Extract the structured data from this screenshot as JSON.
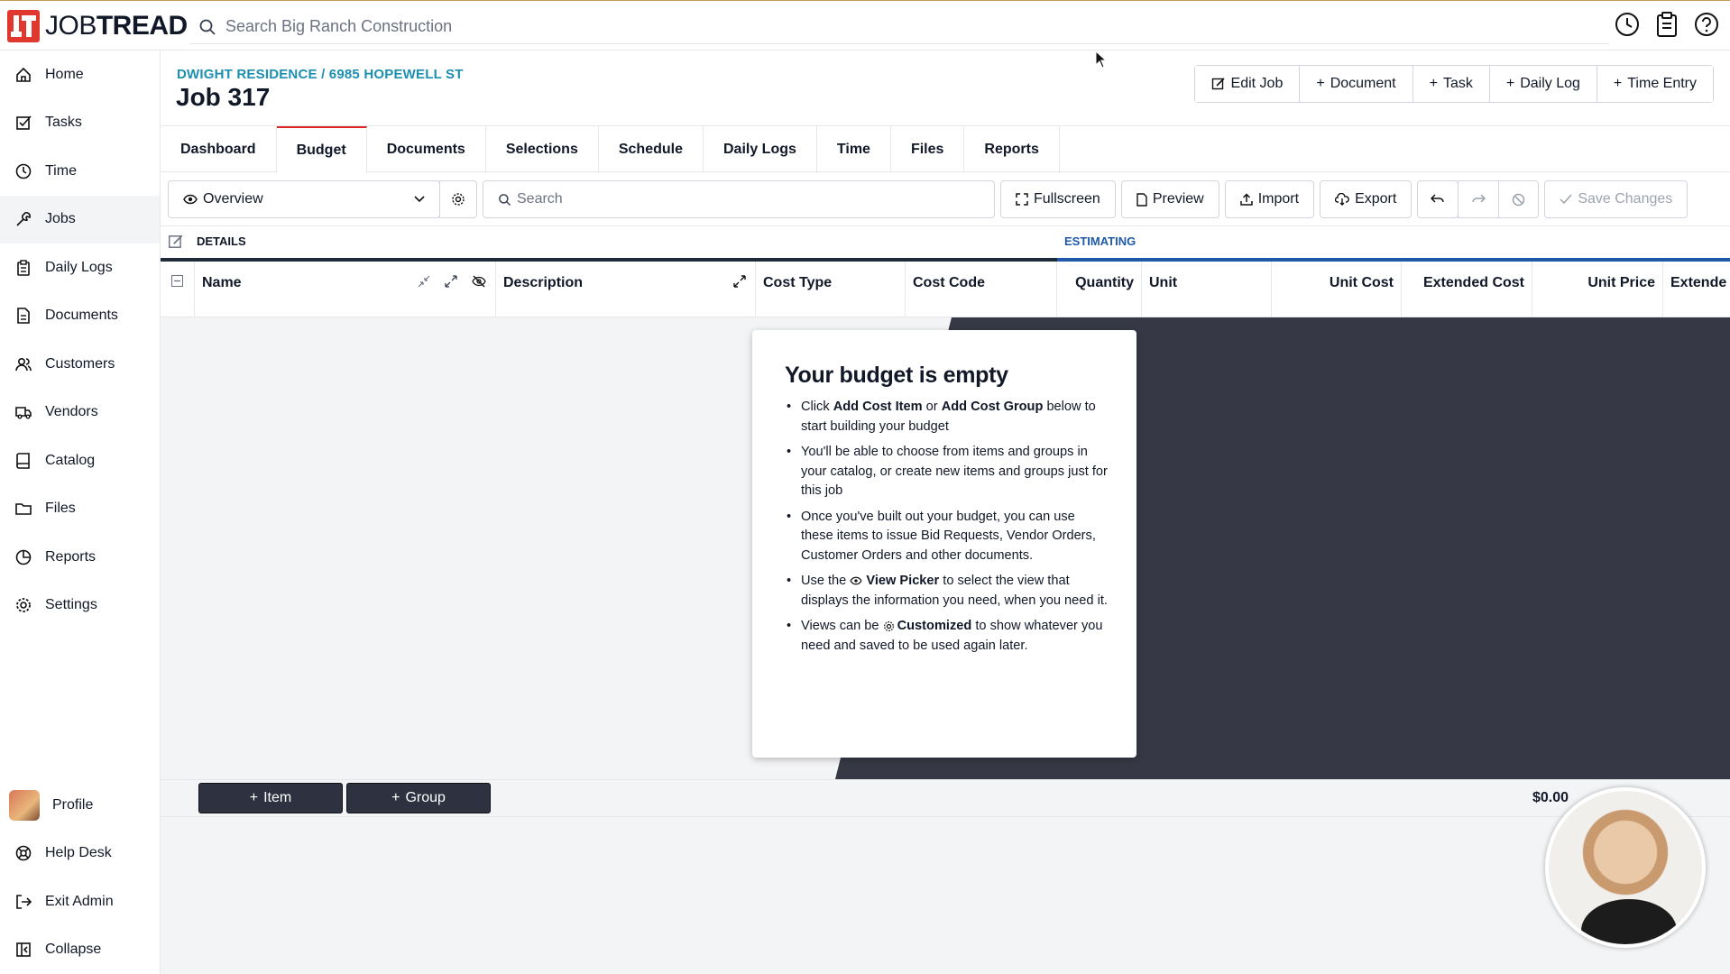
{
  "brand": {
    "name_part1": "JOB",
    "name_part2": "TREAD",
    "accent": "#e0382e"
  },
  "global_search": {
    "placeholder": "Search Big Ranch Construction"
  },
  "top_icons": [
    "clock-icon",
    "clipboard-icon",
    "help-icon"
  ],
  "sidebar": {
    "items": [
      {
        "label": "Home",
        "icon": "home-icon"
      },
      {
        "label": "Tasks",
        "icon": "checkbox-icon"
      },
      {
        "label": "Time",
        "icon": "clock-icon"
      },
      {
        "label": "Jobs",
        "icon": "wrench-icon",
        "active": true
      },
      {
        "label": "Daily Logs",
        "icon": "clipboard-icon"
      },
      {
        "label": "Documents",
        "icon": "document-icon"
      },
      {
        "label": "Customers",
        "icon": "users-icon"
      },
      {
        "label": "Vendors",
        "icon": "truck-icon"
      },
      {
        "label": "Catalog",
        "icon": "book-icon"
      },
      {
        "label": "Files",
        "icon": "folder-icon"
      },
      {
        "label": "Reports",
        "icon": "chart-icon"
      },
      {
        "label": "Settings",
        "icon": "gear-icon"
      }
    ],
    "bottom": [
      {
        "label": "Profile",
        "icon": "avatar"
      },
      {
        "label": "Help Desk",
        "icon": "lifebuoy-icon"
      },
      {
        "label": "Exit Admin",
        "icon": "exit-icon"
      },
      {
        "label": "Collapse",
        "icon": "collapse-icon"
      }
    ]
  },
  "job": {
    "breadcrumb": "DWIGHT RESIDENCE / 6985 HOPEWELL ST",
    "title": "Job 317"
  },
  "actions": [
    "Edit Job",
    "Document",
    "Task",
    "Daily Log",
    "Time Entry"
  ],
  "tabs": [
    "Dashboard",
    "Budget",
    "Documents",
    "Selections",
    "Schedule",
    "Daily Logs",
    "Time",
    "Files",
    "Reports"
  ],
  "active_tab": "Budget",
  "toolbar": {
    "view": "Overview",
    "search_placeholder": "Search",
    "fullscreen": "Fullscreen",
    "preview": "Preview",
    "import": "Import",
    "export": "Export",
    "save": "Save Changes"
  },
  "sections": {
    "details": "DETAILS",
    "estimating": "ESTIMATING",
    "estimating_color": "#1e5aa8"
  },
  "columns": [
    "Name",
    "Description",
    "Cost Type",
    "Cost Code",
    "Quantity",
    "Unit",
    "Unit Cost",
    "Extended Cost",
    "Unit Price",
    "Extende"
  ],
  "empty_state": {
    "title": "Your budget is empty",
    "b1_pre": "Click ",
    "b1_bold1": "Add Cost Item",
    "b1_mid": " or ",
    "b1_bold2": "Add Cost Group",
    "b1_post": " below to start building your budget",
    "b2": "You'll be able to choose from items and groups in your catalog, or create new items and groups just for this job",
    "b3": "Once you've built out your budget, you can use these items to issue Bid Requests, Vendor Orders, Customer Orders and other documents.",
    "b4_pre": "Use the ",
    "b4_bold": "View Picker",
    "b4_post": " to select the view that displays the information you need, when you need it.",
    "b5_pre": "Views can be ",
    "b5_bold": "Customized",
    "b5_post": " to show whatever you need and saved to be used again later."
  },
  "footer": {
    "add_item": "Item",
    "add_group": "Group",
    "total": "$0.00"
  }
}
